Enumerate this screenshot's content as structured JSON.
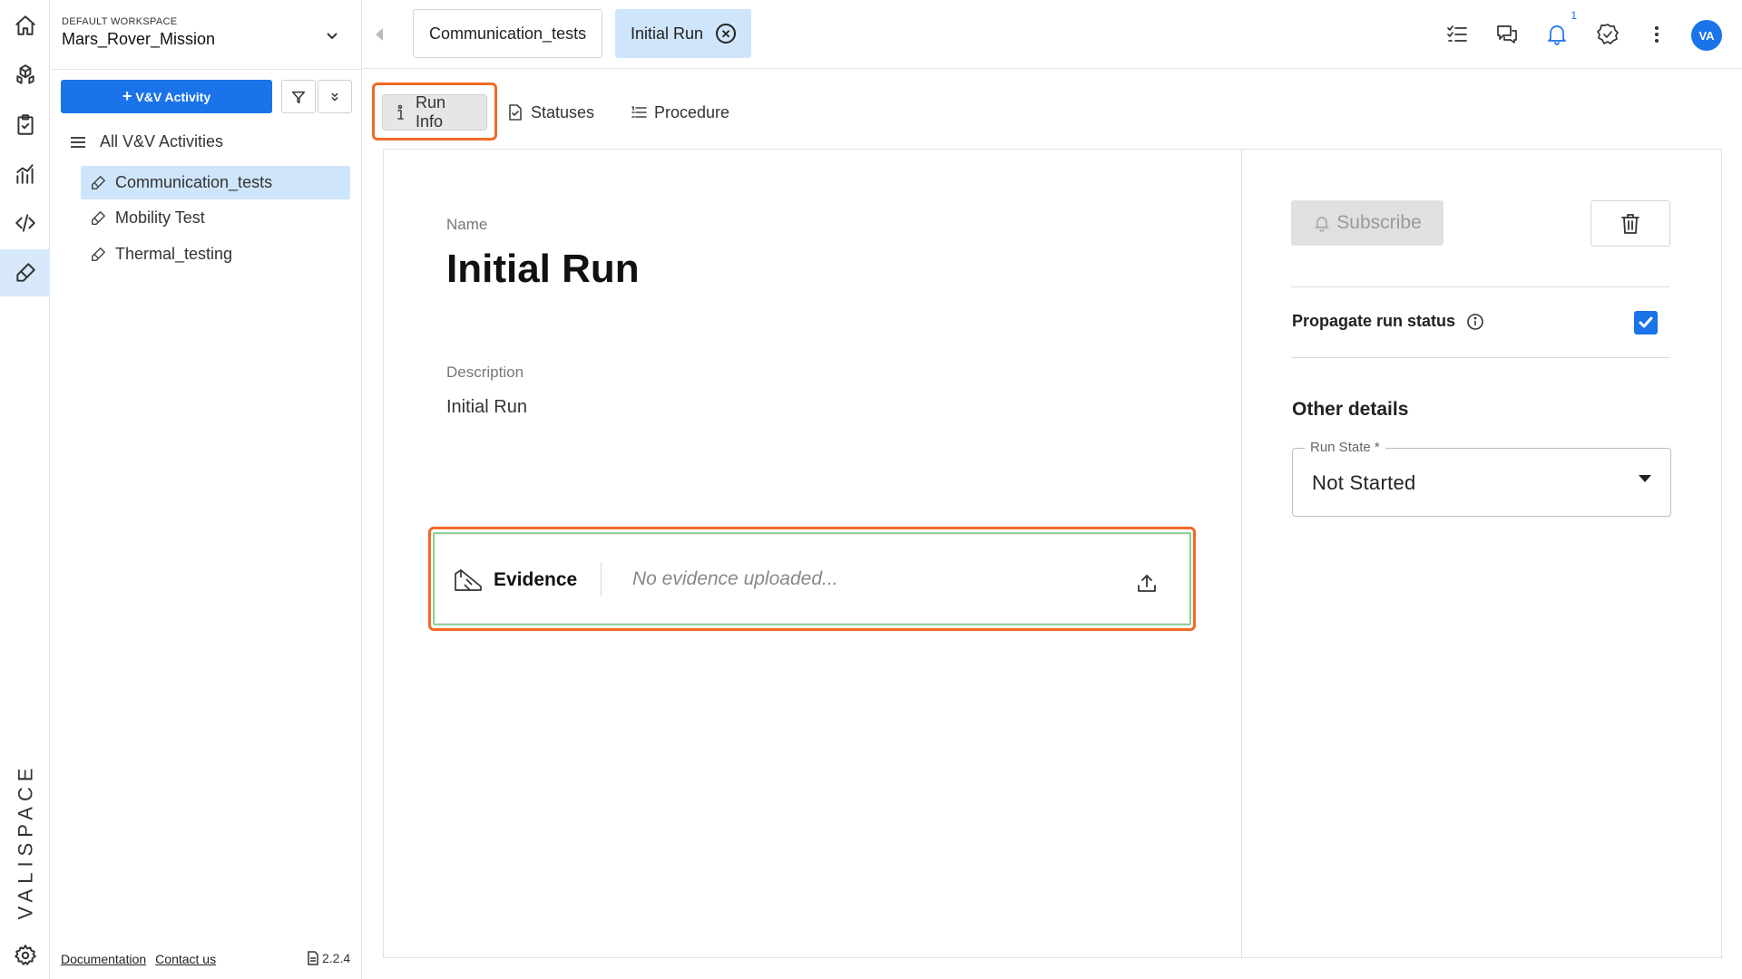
{
  "rail": {
    "items": [
      "home-icon",
      "components-icon",
      "requirements-icon",
      "analytics-icon",
      "code-icon",
      "test-icon"
    ],
    "active": "test-icon",
    "brand": "VALISPACE",
    "settings_icon": "gear-icon"
  },
  "sidebar": {
    "workspace_caption": "DEFAULT WORKSPACE",
    "workspace_name": "Mars_Rover_Mission",
    "add_button": "V&V Activity",
    "add_plus": "+",
    "tree_root": "All V&V Activities",
    "items": [
      {
        "label": "Communication_tests",
        "selected": true
      },
      {
        "label": "Mobility Test",
        "selected": false
      },
      {
        "label": "Thermal_testing",
        "selected": false
      }
    ],
    "footer": {
      "documentation": "Documentation",
      "contact": "Contact us",
      "version": "2.2.4"
    }
  },
  "tabs": [
    {
      "label": "Communication_tests",
      "active": false
    },
    {
      "label": "Initial Run",
      "active": true,
      "close": "✕"
    }
  ],
  "topbar": {
    "notification_count": "1",
    "avatar": "VA",
    "accent": "#1a73e8"
  },
  "subtabs": [
    {
      "label": "Run Info",
      "active": true
    },
    {
      "label": "Statuses",
      "active": false
    },
    {
      "label": "Procedure",
      "active": false
    }
  ],
  "run": {
    "name_label": "Name",
    "name": "Initial Run",
    "description_label": "Description",
    "description": "Initial Run",
    "evidence_label": "Evidence",
    "evidence_empty": "No evidence uploaded..."
  },
  "details": {
    "subscribe": "Subscribe",
    "propagate_label": "Propagate run status",
    "propagate_checked": true,
    "other_title": "Other details",
    "run_state_label": "Run State *",
    "run_state_value": "Not Started"
  },
  "colors": {
    "primary": "#1a73e8",
    "highlight": "#f06a27",
    "selected_bg": "#cfe5fb"
  }
}
